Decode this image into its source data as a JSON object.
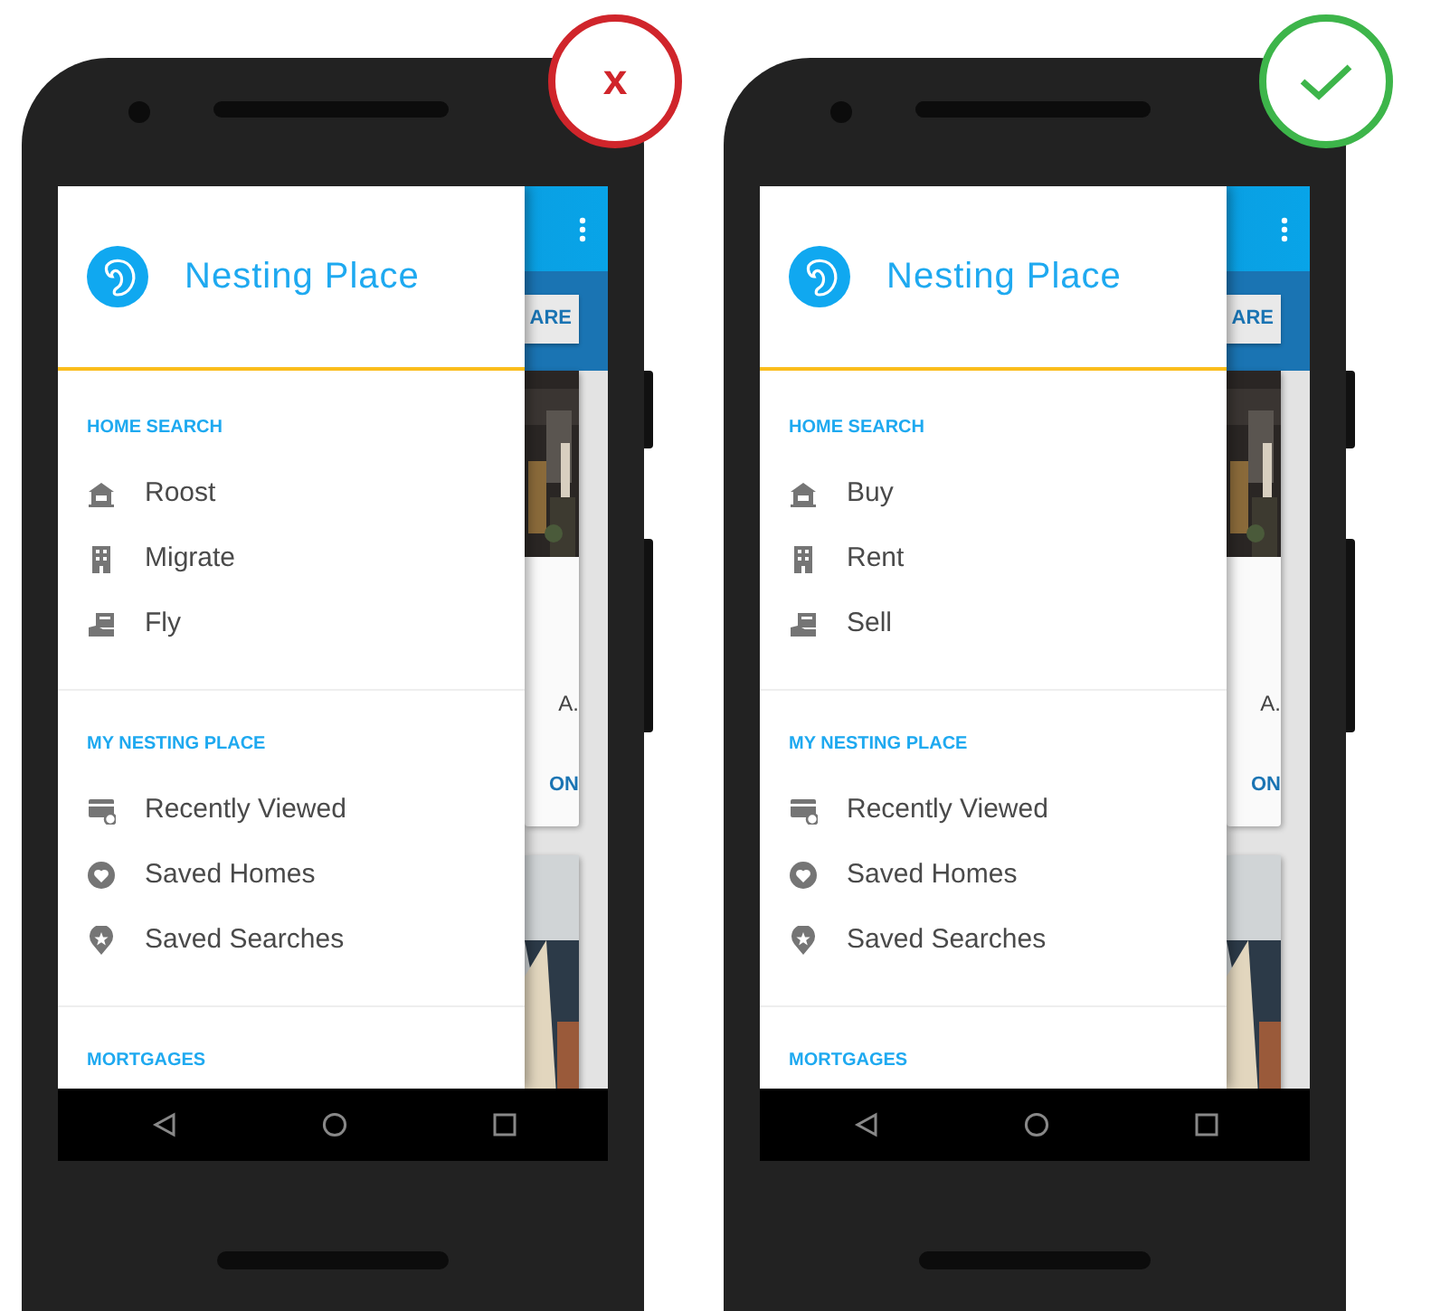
{
  "phones": [
    {
      "verdict": {
        "kind": "wrong",
        "mark": "x"
      },
      "drawer": {
        "title": "Nesting Place",
        "sections": [
          {
            "heading": "HOME SEARCH",
            "items": [
              {
                "kind": "house",
                "label": "Roost"
              },
              {
                "kind": "building",
                "label": "Migrate"
              },
              {
                "kind": "sign",
                "label": "Fly"
              }
            ]
          },
          {
            "heading": "MY NESTING PLACE",
            "items": [
              {
                "kind": "recent",
                "label": "Recently Viewed"
              },
              {
                "kind": "heart",
                "label": "Saved Homes"
              },
              {
                "kind": "pin",
                "label": "Saved Searches"
              }
            ]
          },
          {
            "heading": "MORTGAGES"
          }
        ]
      },
      "behind": {
        "button": "ARE",
        "card_text": "A.",
        "card_link": "ON"
      }
    },
    {
      "verdict": {
        "kind": "right"
      },
      "drawer": {
        "title": "Nesting Place",
        "sections": [
          {
            "heading": "HOME SEARCH",
            "items": [
              {
                "kind": "house",
                "label": "Buy"
              },
              {
                "kind": "building",
                "label": "Rent"
              },
              {
                "kind": "sign",
                "label": "Sell"
              }
            ]
          },
          {
            "heading": "MY NESTING PLACE",
            "items": [
              {
                "kind": "recent",
                "label": "Recently Viewed"
              },
              {
                "kind": "heart",
                "label": "Saved Homes"
              },
              {
                "kind": "pin",
                "label": "Saved Searches"
              }
            ]
          },
          {
            "heading": "MORTGAGES"
          }
        ]
      },
      "behind": {
        "button": "ARE",
        "card_text": "A.",
        "card_link": "ON"
      }
    }
  ]
}
